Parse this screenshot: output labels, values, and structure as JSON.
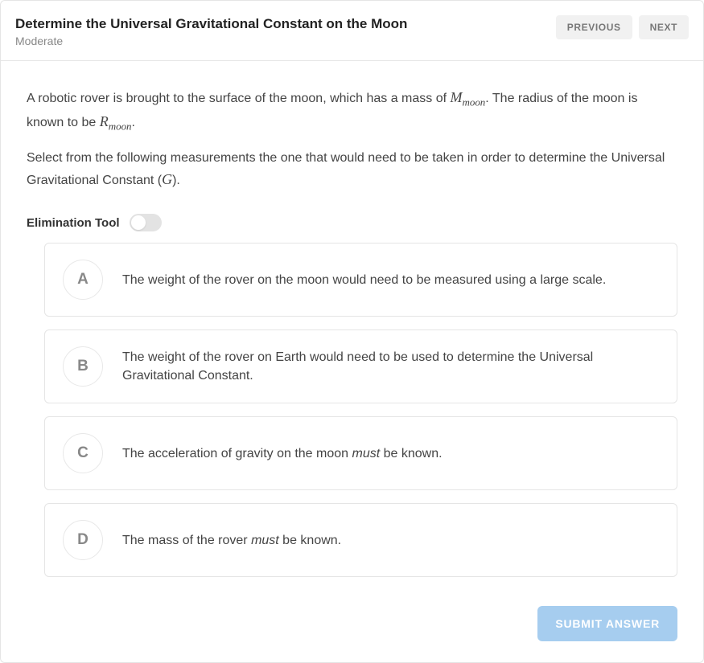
{
  "header": {
    "title": "Determine the Universal Gravitational Constant on the Moon",
    "difficulty": "Moderate",
    "previous_label": "PREVIOUS",
    "next_label": "NEXT"
  },
  "prompt": {
    "part1_pre": "A robotic rover is brought to the surface of the moon, which has a mass of ",
    "mass_symbol_base": "M",
    "mass_symbol_sub": "moon",
    "part1_mid": ". The radius of the moon is known to be ",
    "radius_symbol_base": "R",
    "radius_symbol_sub": "moon",
    "part1_end": ".",
    "part2_pre": "Select from the following measurements the one that would need to be taken in order to determine the Universal Gravitational Constant (",
    "g_symbol": "G",
    "part2_end": ")."
  },
  "elimination": {
    "label": "Elimination Tool",
    "enabled": false
  },
  "options": [
    {
      "letter": "A",
      "text_pre": "The weight of the rover on the moon would need to be measured using a large scale.",
      "emph": "",
      "text_post": ""
    },
    {
      "letter": "B",
      "text_pre": "The weight of the rover on Earth would need to be used to determine the Universal Gravitational Constant.",
      "emph": "",
      "text_post": ""
    },
    {
      "letter": "C",
      "text_pre": "The acceleration of gravity on the moon ",
      "emph": "must",
      "text_post": " be known."
    },
    {
      "letter": "D",
      "text_pre": "The mass of the rover ",
      "emph": "must",
      "text_post": " be known."
    }
  ],
  "submit_label": "SUBMIT ANSWER"
}
